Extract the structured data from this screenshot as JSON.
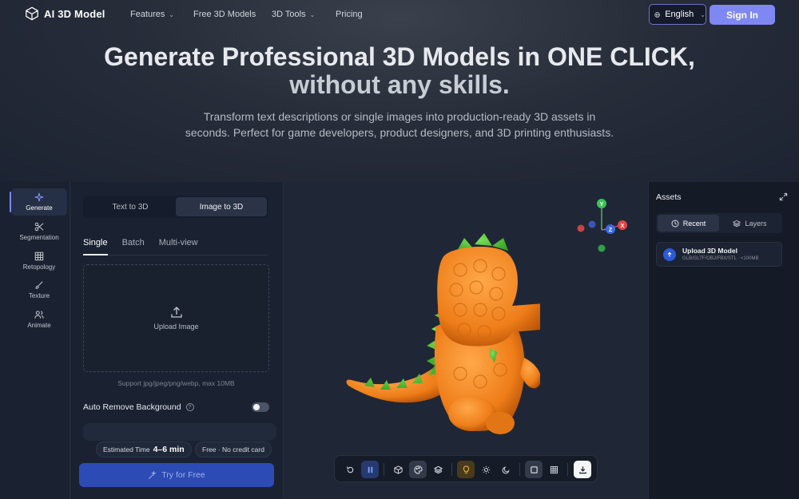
{
  "nav": {
    "brand": "AI 3D Model",
    "links": [
      {
        "label": "Features",
        "has_caret": true
      },
      {
        "label": "Free 3D Models",
        "has_caret": false
      },
      {
        "label": "3D Tools",
        "has_caret": true
      },
      {
        "label": "Pricing",
        "has_caret": false
      }
    ],
    "language": "English",
    "signin": "Sign In",
    "accent": "#7f87f2"
  },
  "hero": {
    "title_line1": "Generate Professional 3D Models in ONE CLICK,",
    "title_line2": "without any skills.",
    "subtitle": "Transform text descriptions or single images into production-ready 3D assets in seconds. Perfect for game developers, product designers, and 3D printing enthusiasts."
  },
  "rail": {
    "items": [
      {
        "label": "Generate",
        "icon": "sparkle-icon",
        "active": true
      },
      {
        "label": "Segmentation",
        "icon": "scissors-icon",
        "active": false
      },
      {
        "label": "Retopology",
        "icon": "grid-icon",
        "active": false
      },
      {
        "label": "Texture",
        "icon": "brush-icon",
        "active": false
      },
      {
        "label": "Animate",
        "icon": "people-icon",
        "active": false
      }
    ]
  },
  "panel": {
    "mode_tabs": [
      "Text to 3D",
      "Image to 3D"
    ],
    "mode_selected": "Image to 3D",
    "sub_tabs": [
      "Single",
      "Batch",
      "Multi-view"
    ],
    "sub_selected": "Single",
    "upload_label": "Upload Image",
    "support_text": "Support jpg/jpeg/png/webp, max 10MB",
    "auto_remove_label": "Auto Remove Background",
    "auto_remove_enabled": false,
    "estimated_label": "Estimated Time",
    "estimated_value": "4–6 min",
    "free_label": "Free · No credit card",
    "try_label": "Try for Free"
  },
  "viewport": {
    "gizmo_axes": [
      "Y",
      "X",
      "Z"
    ],
    "toolbar_icons": [
      "reset-icon",
      "pause-icon",
      "cube-icon",
      "palette-icon",
      "layers-icon",
      "bulb-icon",
      "sun-icon",
      "moon-icon",
      "square-icon",
      "wireframe-icon",
      "download-icon"
    ],
    "model_colors": {
      "body": "#f08a24",
      "spikes": "#5dc83a"
    }
  },
  "assets": {
    "title": "Assets",
    "tabs": [
      "Recent",
      "Layers"
    ],
    "tab_selected": "Recent",
    "upload_title": "Upload 3D Model",
    "upload_formats": "GLB/GLTF/OBJ/FBX/STL · <100MB"
  }
}
